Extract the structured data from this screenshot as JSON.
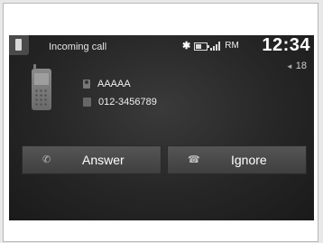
{
  "status_bar": {
    "title": "Incoming call",
    "roaming": "RM",
    "clock": "12:34",
    "icons": [
      "phone-icon",
      "bluetooth-icon",
      "battery-icon",
      "signal-icon"
    ]
  },
  "volume": {
    "value": "18",
    "icon": "speaker-icon"
  },
  "caller": {
    "name": "AAAAA",
    "number": "012-3456789",
    "icon": "cell-phone-icon"
  },
  "actions": {
    "answer_label": "Answer",
    "ignore_label": "Ignore"
  }
}
